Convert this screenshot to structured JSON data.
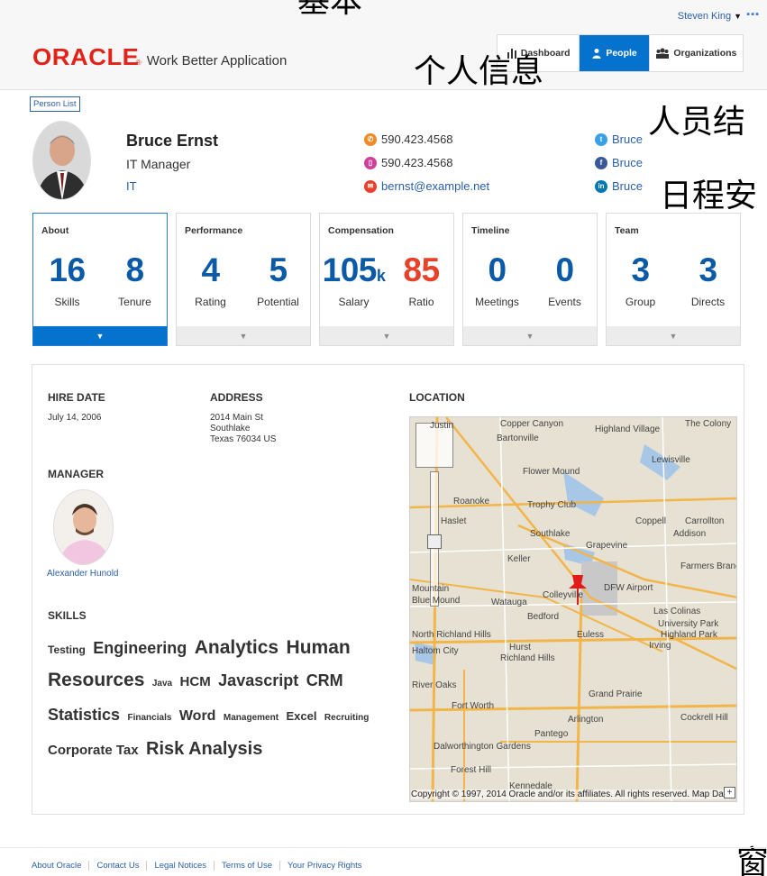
{
  "header": {
    "user_name": "Steven King",
    "app_title": "Work Better Application",
    "logo_text": "ORACLE",
    "tabs": [
      {
        "label": "Dashboard",
        "icon": "bar-chart-icon"
      },
      {
        "label": "People",
        "icon": "person-icon"
      },
      {
        "label": "Organizations",
        "icon": "group-icon"
      }
    ],
    "active_tab": "People"
  },
  "overlay_text": {
    "top_partial": "基本",
    "personal_info": "个人信息",
    "org_structure": "人员结",
    "schedule": "日程安",
    "bottom_partial": "窗"
  },
  "person_list_label": "Person List",
  "person": {
    "name": "Bruce Ernst",
    "title": "IT Manager",
    "department": "IT",
    "phone_work": "590.423.4568",
    "phone_mobile": "590.423.4568",
    "email": "bernst@example.net",
    "twitter": "Bruce",
    "facebook": "Bruce",
    "linkedin": "Bruce"
  },
  "cards": [
    {
      "title": "About",
      "metrics": [
        {
          "value": "16",
          "label": "Skills"
        },
        {
          "value": "8",
          "label": "Tenure"
        }
      ],
      "active": true
    },
    {
      "title": "Performance",
      "metrics": [
        {
          "value": "4",
          "label": "Rating"
        },
        {
          "value": "5",
          "label": "Potential"
        }
      ],
      "active": false
    },
    {
      "title": "Compensation",
      "metrics": [
        {
          "value": "105",
          "unit": "k",
          "label": "Salary"
        },
        {
          "value": "85",
          "label": "Ratio"
        }
      ],
      "active": false
    },
    {
      "title": "Timeline",
      "metrics": [
        {
          "value": "0",
          "label": "Meetings"
        },
        {
          "value": "0",
          "label": "Events"
        }
      ],
      "active": false
    },
    {
      "title": "Team",
      "metrics": [
        {
          "value": "3",
          "label": "Group"
        },
        {
          "value": "3",
          "label": "Directs"
        }
      ],
      "active": false
    }
  ],
  "details": {
    "hire_date_label": "HIRE DATE",
    "hire_date": "July 14, 2006",
    "address_label": "ADDRESS",
    "address_line1": "2014 Main St",
    "address_line2": "Southlake",
    "address_line3": "Texas 76034 US",
    "location_label": "LOCATION",
    "manager_label": "MANAGER",
    "manager_name": "Alexander Hunold",
    "skills_label": "SKILLS"
  },
  "skills": [
    {
      "text": "Testing",
      "size": 12
    },
    {
      "text": "Engineering",
      "size": 18
    },
    {
      "text": "Analytics",
      "size": 21
    },
    {
      "text": "Human Resources",
      "size": 21
    },
    {
      "text": "Java",
      "size": 10
    },
    {
      "text": "HCM",
      "size": 15
    },
    {
      "text": "Javascript",
      "size": 18
    },
    {
      "text": "CRM",
      "size": 18
    },
    {
      "text": "Statistics",
      "size": 18
    },
    {
      "text": "Financials",
      "size": 10
    },
    {
      "text": "Word",
      "size": 16
    },
    {
      "text": "Management",
      "size": 10
    },
    {
      "text": "Excel",
      "size": 13
    },
    {
      "text": "Recruiting",
      "size": 10
    },
    {
      "text": "Corporate Tax",
      "size": 15
    },
    {
      "text": "Risk Analysis",
      "size": 20
    }
  ],
  "map": {
    "places": [
      "Copper Canyon",
      "Highland Village",
      "The Colony",
      "Justin",
      "Bartonville",
      "Lewisville",
      "Flower Mound",
      "Roanoke",
      "Trophy Club",
      "Haslet",
      "Coppell",
      "Carrollton",
      "Southlake",
      "Addison",
      "Grapevine",
      "Farmers Branch",
      "Keller",
      "DFW Airport",
      "Mountain",
      "Colleyville",
      "Las Colinas",
      "Blue Mound",
      "Watauga",
      "Bedford",
      "University Park",
      "North Richland Hills",
      "Euless",
      "Highland Park",
      "Haltom City",
      "Hurst",
      "Irving",
      "Richland Hills",
      "River Oaks",
      "Grand Prairie",
      "Fort Worth",
      "Arlington",
      "Cockrell Hill",
      "Pantego",
      "Dalworthington Gardens",
      "Forest Hill",
      "Kennedale"
    ],
    "copyright": "Copyright © 1997, 2014 Oracle and/or its affiliates. All rights reserved. Map Data"
  },
  "footer": {
    "links": [
      "About Oracle",
      "Contact Us",
      "Legal Notices",
      "Terms of Use",
      "Your Privacy Rights"
    ]
  },
  "colors": {
    "oracle_red": "#e2231a",
    "accent_blue": "#0572ce",
    "metric_blue": "#0a5aa8",
    "ratio_red": "#e8412a"
  }
}
